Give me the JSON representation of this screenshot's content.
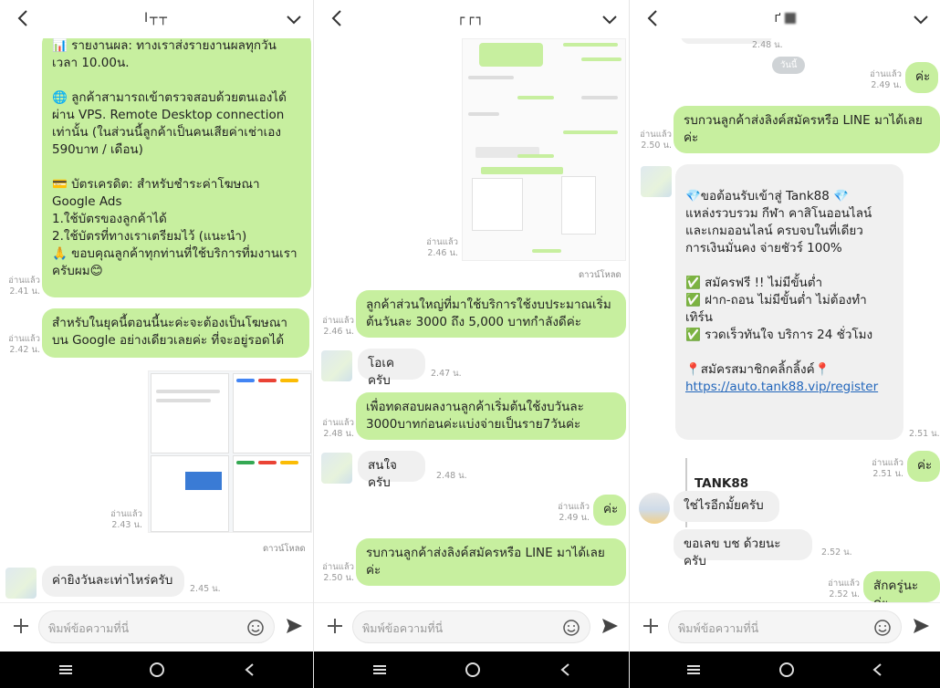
{
  "screens": [
    {
      "title": "I┬┬",
      "input_placeholder": "พิมพ์ข้อความที่นี่",
      "promo_text": "📊 รายงานผล: ทางเราส่งรายงานผลทุกวัน\nเวลา 10.00น.\n\n🌐 ลูกค้าสามารถเข้าตรวจสอบด้วยตนเองได้\nผ่าน VPS. Remote Desktop connection\nเท่านั้น (ในส่วนนี้ลูกค้าเป็นคนเสียค่าเช่าเอง\n590บาท / เดือน)\n\n💳 บัตรเครดิต: สำหรับชำระค่าโฆษณา\nGoogle Ads\n1.ใช้บัตรของลูกค้าได้\n2.ใช้บัตรที่ทางเราเตรียมไว้ (แนะนำ)\n🙏 ขอบคุณลูกค้าทุกท่านที่ใช้บริการที่มงานเรา\nครับผม😊",
      "promo_read": "อ่านแล้ว",
      "promo_time": "2.41 น.",
      "google_text": "สำหรับในยุคนี้ตอนนี้นะค่ะจะต้องเป็นโฆษณา\nบน Google อย่างเดียวเลยค่ะ ที่จะอยู่รอดได้",
      "google_read": "อ่านแล้ว",
      "google_time": "2.42 น.",
      "image_read": "อ่านแล้ว",
      "image_time": "2.43 น.",
      "download_label": "ดาวน์โหลด",
      "question_text": "ค่ายิงวันละเท่าไหร่ครับ",
      "question_time": "2.45 น."
    },
    {
      "title": "┌┌┐",
      "input_placeholder": "พิมพ์ข้อความที่นี่",
      "image_read": "อ่านแล้ว",
      "image_time": "2.46 น.",
      "download_label": "ดาวน์โหลด",
      "budget_text": "ลูกค้าส่วนใหญ่ที่มาใช้บริการใช้งบประมาณเริ่ม\nต้นวันละ 3000 ถึง 5,000 บาทกำลังดีค่ะ",
      "budget_read": "อ่านแล้ว",
      "budget_time": "2.46 น.",
      "ok_text": "โอเคครับ",
      "ok_time": "2.47 น.",
      "test_text": "เพื่อทดสอบผลงานลูกค้าเริ่มต้นใช้งบวันละ\n3000บาทก่อนค่ะแบ่งจ่ายเป็นราย7วันค่ะ",
      "test_read": "อ่านแล้ว",
      "test_time": "2.48 น.",
      "interested_text": "สนใจครับ",
      "interested_time": "2.48 น.",
      "ka_text": "ค่ะ",
      "ka_read": "อ่านแล้ว",
      "ka_time": "2.49 น.",
      "signup_text": "รบกวนลูกค้าส่งลิงค์สมัครหรือ LINE มาได้เลย\nค่ะ",
      "signup_read": "อ่านแล้ว",
      "signup_time": "2.50 น."
    },
    {
      "title": "ґ",
      "input_placeholder": "พิมพ์ข้อความที่นี่",
      "top_time": "2.48 น.",
      "date_chip": "วันนี้",
      "ka_read": "อ่านแล้ว",
      "ka_time": "2.49 น.",
      "ka_text": "ค่ะ",
      "signup_text": "รบกวนลูกค้าส่งลิงค์สมัครหรือ LINE มาได้เลย\nค่ะ",
      "signup_read": "อ่านแล้ว",
      "signup_time": "2.50 น.",
      "welcome_text": "💎ขอต้อนรับเข้าสู่ Tank88 💎\nแหล่งรวบรวม กีฬา คาสิโนออนไลน์\nและเกมออนไลน์ ครบจบในที่เดียว\nการเงินมั่นคง จ่ายชัวร์ 100%\n\n✅ สมัครฟรี !! ไม่มีขั้นต่ำ\n✅ ฝาก-ถอน ไม่มีขั้นต่ำ ไม่ต้องทำเทิร์น\n✅ รวดเร็วทันใจ บริการ 24 ชั่วโมง\n\n📍สมัครสมาชิกคลิ้กลิ้งค์📍",
      "welcome_link": "https://auto.tank88.vip/register",
      "card_title": "TANK88",
      "card_sub": "TANK88",
      "welcome_time": "2.51 น.",
      "ka2_read": "อ่านแล้ว",
      "ka2_time": "2.51 น.",
      "ka2_text": "ค่ะ",
      "is_it_text": "ใช่ไรอีกมั้ยครับ",
      "account_text": "ขอเลข บช ด้วยนะครับ",
      "account_time": "2.52 น.",
      "apply_read": "อ่านแล้ว",
      "apply_time": "2.52 น.",
      "apply_text": "สักครู่นะค่ะ"
    }
  ],
  "colors": {
    "bubble_out": "#c7ef9f",
    "bubble_in": "#f0f0f0",
    "nav_bg": "#000000",
    "link": "#2266bb"
  },
  "icons": {
    "back": "back-arrow-icon",
    "chevron": "chevron-down-icon",
    "plus": "plus-icon",
    "emoji": "emoji-icon",
    "send": "send-icon",
    "nav_menu": "menu-icon",
    "nav_home": "home-icon",
    "nav_back": "nav-back-icon"
  }
}
